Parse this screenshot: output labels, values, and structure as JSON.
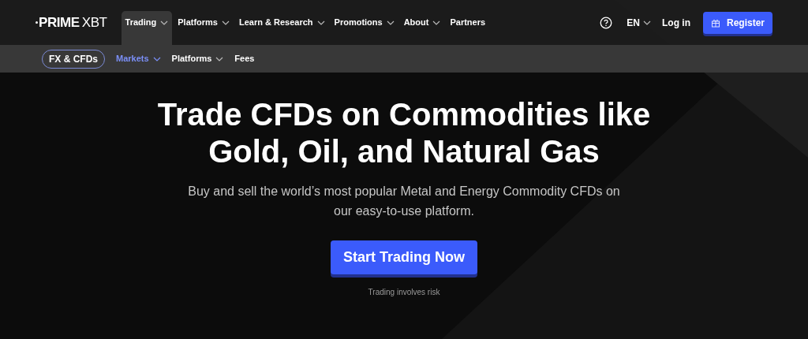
{
  "logo": {
    "bold": "PRIME",
    "light": "XBT"
  },
  "main_nav": [
    {
      "label": "Trading",
      "selected": true,
      "dropdown": true
    },
    {
      "label": "Platforms",
      "selected": false,
      "dropdown": true
    },
    {
      "label": "Learn & Research",
      "selected": false,
      "dropdown": true
    },
    {
      "label": "Promotions",
      "selected": false,
      "dropdown": true
    },
    {
      "label": "About",
      "selected": false,
      "dropdown": true
    },
    {
      "label": "Partners",
      "selected": false,
      "dropdown": false
    }
  ],
  "language": "EN",
  "login": "Log in",
  "register": "Register",
  "sub_nav": {
    "section": "FX & CFDs",
    "items": [
      {
        "label": "Markets",
        "selected": true,
        "dropdown": true
      },
      {
        "label": "Platforms",
        "selected": false,
        "dropdown": true
      },
      {
        "label": "Fees",
        "selected": false,
        "dropdown": false
      }
    ]
  },
  "hero": {
    "title_lines": [
      "Trade CFDs on Commodities like",
      "Gold, Oil, and Natural Gas"
    ],
    "subtitle_lines": [
      "Buy and sell the world’s most popular Metal and Energy Commodity CFDs on",
      "our easy-to-use platform."
    ],
    "cta": "Start Trading Now",
    "disclaimer": "Trading involves risk"
  }
}
